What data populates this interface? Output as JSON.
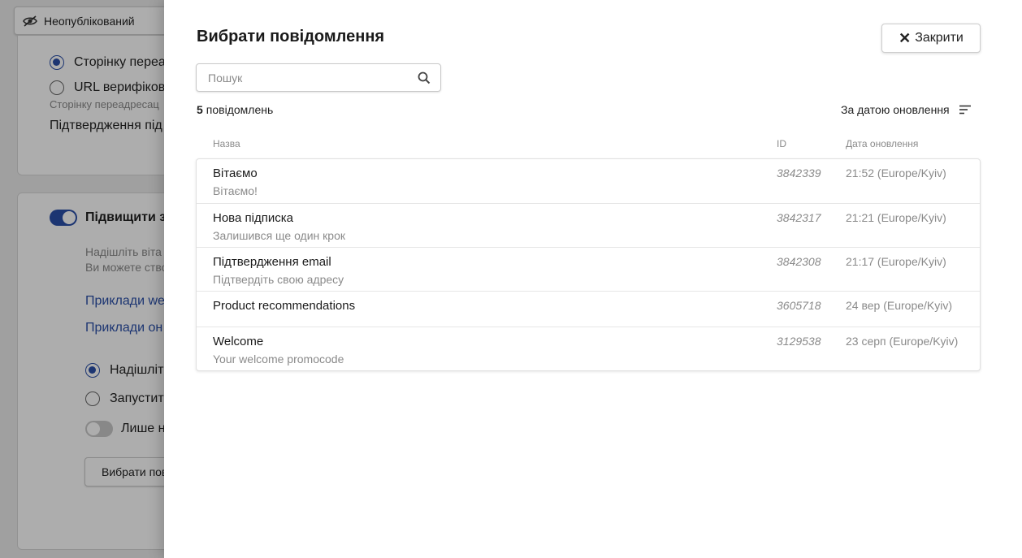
{
  "background": {
    "status_label": "Неопублікований",
    "radio_redirect_label": "Сторінку переа",
    "radio_url_label": "URL верифіков",
    "url_hint": "Сторінку переадресац",
    "confirmation_label": "Підтвердження під",
    "boost_title": "Підвищити з",
    "desc_line1": "Надішліть віта",
    "desc_line2": "Ви можете ство",
    "link1": "Приклади we",
    "link2": "Приклади он",
    "option_send": "Надішліт",
    "option_launch": "Запустит",
    "option_only": "Лише н",
    "choose_button": "Вибрати пов"
  },
  "drawer": {
    "title": "Вибрати повідомлення",
    "close_label": "Закрити",
    "search_placeholder": "Пошук",
    "count_number": "5",
    "count_label": "повідомлень",
    "sort_label": "За датою оновлення",
    "columns": {
      "name": "Назва",
      "id": "ID",
      "date": "Дата оновлення"
    },
    "rows": [
      {
        "name": "Вітаємо",
        "subtitle": "Вітаємо!",
        "id": "3842339",
        "date": "21:52 (Europe/Kyiv)"
      },
      {
        "name": "Нова підписка",
        "subtitle": "Залишився ще один крок",
        "id": "3842317",
        "date": "21:21 (Europe/Kyiv)"
      },
      {
        "name": "Підтвердження email",
        "subtitle": "Підтвердіть свою адресу",
        "id": "3842308",
        "date": "21:17 (Europe/Kyiv)"
      },
      {
        "name": "Product recommendations",
        "subtitle": "",
        "id": "3605718",
        "date": "24 вер (Europe/Kyiv)"
      },
      {
        "name": "Welcome",
        "subtitle": "Your welcome promocode",
        "id": "3129538",
        "date": "23 серп (Europe/Kyiv)"
      }
    ]
  },
  "colors": {
    "accent": "#2a4fa8",
    "muted_text": "#8a8a8a",
    "overlay": "rgba(0,0,0,0.32)"
  }
}
